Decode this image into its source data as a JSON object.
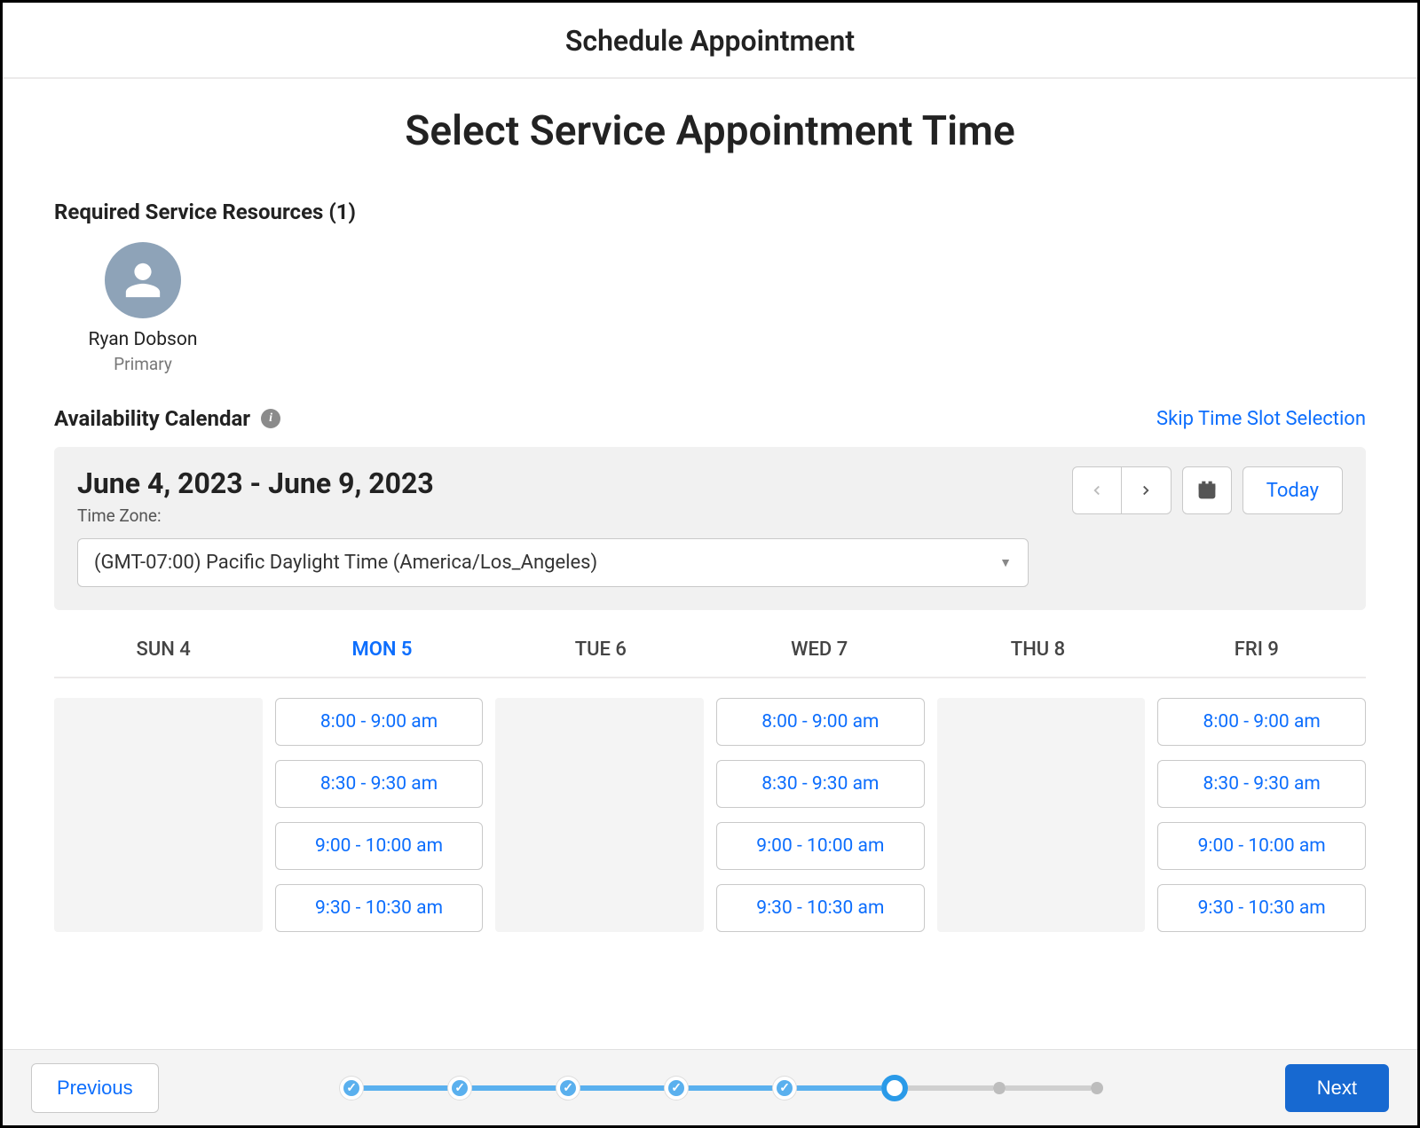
{
  "window": {
    "title": "Schedule Appointment"
  },
  "page": {
    "title": "Select Service Appointment Time"
  },
  "resources": {
    "section_label": "Required Service Resources (1)",
    "items": [
      {
        "name": "Ryan Dobson",
        "role": "Primary"
      }
    ]
  },
  "calendar": {
    "section_label": "Availability Calendar",
    "skip_label": "Skip Time Slot Selection",
    "date_range": "June 4, 2023 - June 9, 2023",
    "tz_label": "Time Zone:",
    "tz_value": "(GMT-07:00) Pacific Daylight Time (America/Los_Angeles)",
    "today_label": "Today",
    "days": [
      {
        "label": "SUN 4",
        "active": false
      },
      {
        "label": "MON 5",
        "active": true
      },
      {
        "label": "TUE 6",
        "active": false
      },
      {
        "label": "WED 7",
        "active": false
      },
      {
        "label": "THU 8",
        "active": false
      },
      {
        "label": "FRI 9",
        "active": false
      }
    ],
    "slots": [
      [],
      [
        "8:00 - 9:00 am",
        "8:30 - 9:30 am",
        "9:00 - 10:00 am",
        "9:30 - 10:30 am"
      ],
      [],
      [
        "8:00 - 9:00 am",
        "8:30 - 9:30 am",
        "9:00 - 10:00 am",
        "9:30 - 10:30 am"
      ],
      [],
      [
        "8:00 - 9:00 am",
        "8:30 - 9:30 am",
        "9:00 - 10:00 am",
        "9:30 - 10:30 am"
      ]
    ]
  },
  "footer": {
    "previous": "Previous",
    "next": "Next",
    "steps": [
      "done",
      "done",
      "done",
      "done",
      "done",
      "current",
      "pending",
      "pending"
    ]
  }
}
